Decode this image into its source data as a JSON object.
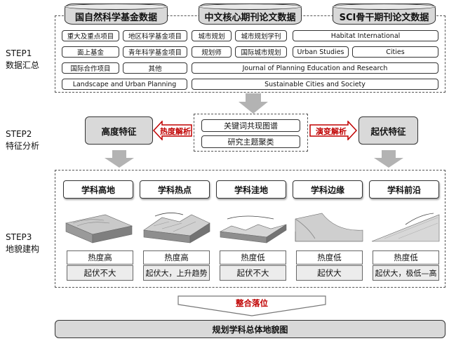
{
  "steps": {
    "s1": {
      "label": "STEP1",
      "sub": "数据汇总"
    },
    "s2": {
      "label": "STEP2",
      "sub": "特征分析"
    },
    "s3": {
      "label": "STEP3",
      "sub": "地貌建构"
    }
  },
  "sources": [
    "国自然科学基金数据",
    "中文核心期刊论文数据",
    "SCI骨干期刊论文数据"
  ],
  "data_items": {
    "r1": [
      "重大及重点项目",
      "地区科学基金项目",
      "城市规划",
      "城市规划学刊",
      "Habitat International"
    ],
    "r2": [
      "面上基金",
      "青年科学基金项目",
      "规划师",
      "国际城市规划",
      "Urban Studies",
      "Cities"
    ],
    "r3": [
      "国际合作项目",
      "其他",
      "Journal of Planning Education and Research"
    ],
    "r4": [
      "Landscape and Urban Planning",
      "Sustainable Cities and Society"
    ]
  },
  "analysis": {
    "left": "高度特征",
    "right": "起伏特征",
    "left_arrow": "热度解析",
    "right_arrow": "演变解析",
    "center": [
      "关键词共现图谱",
      "研究主题聚类"
    ]
  },
  "categories": [
    {
      "name": "学科高地",
      "heat": "热度高",
      "relief": "起伏不大"
    },
    {
      "name": "学科热点",
      "heat": "热度高",
      "relief": "起伏大，上升趋势"
    },
    {
      "name": "学科洼地",
      "heat": "热度低",
      "relief": "起伏不大"
    },
    {
      "name": "学科边缘",
      "heat": "热度低",
      "relief": "起伏大"
    },
    {
      "name": "学科前沿",
      "heat": "热度低",
      "relief": "起伏大，极低—高"
    }
  ],
  "integrate": "整合落位",
  "final": "规划学科总体地貌图",
  "colors": {
    "accent": "#c00000",
    "gray": "#d9d9d9",
    "arrow": "#b3b3b3"
  }
}
